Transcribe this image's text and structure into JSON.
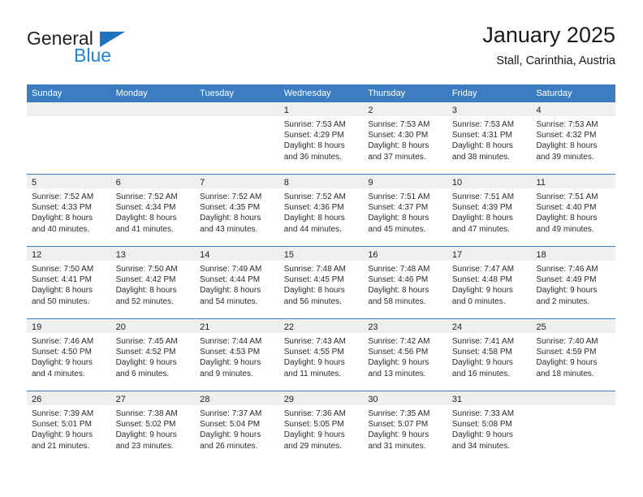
{
  "logo": {
    "word_one": "General",
    "word_two": "Blue",
    "triangle_icon": "triangle-icon",
    "accent_dark": "#1f72bd",
    "accent_light": "#1f86d4"
  },
  "header": {
    "title": "January 2025",
    "subtitle": "Stall, Carinthia, Austria"
  },
  "theme": {
    "header_blue": "#3b7dc0",
    "band_gray": "#efefef",
    "text": "#222222"
  },
  "weekdays": [
    "Sunday",
    "Monday",
    "Tuesday",
    "Wednesday",
    "Thursday",
    "Friday",
    "Saturday"
  ],
  "weeks": [
    [
      {
        "empty": true
      },
      {
        "empty": true
      },
      {
        "empty": true
      },
      {
        "day": "1",
        "sunrise": "Sunrise: 7:53 AM",
        "sunset": "Sunset: 4:29 PM",
        "daylight_1": "Daylight: 8 hours",
        "daylight_2": "and 36 minutes."
      },
      {
        "day": "2",
        "sunrise": "Sunrise: 7:53 AM",
        "sunset": "Sunset: 4:30 PM",
        "daylight_1": "Daylight: 8 hours",
        "daylight_2": "and 37 minutes."
      },
      {
        "day": "3",
        "sunrise": "Sunrise: 7:53 AM",
        "sunset": "Sunset: 4:31 PM",
        "daylight_1": "Daylight: 8 hours",
        "daylight_2": "and 38 minutes."
      },
      {
        "day": "4",
        "sunrise": "Sunrise: 7:53 AM",
        "sunset": "Sunset: 4:32 PM",
        "daylight_1": "Daylight: 8 hours",
        "daylight_2": "and 39 minutes."
      }
    ],
    [
      {
        "day": "5",
        "sunrise": "Sunrise: 7:52 AM",
        "sunset": "Sunset: 4:33 PM",
        "daylight_1": "Daylight: 8 hours",
        "daylight_2": "and 40 minutes."
      },
      {
        "day": "6",
        "sunrise": "Sunrise: 7:52 AM",
        "sunset": "Sunset: 4:34 PM",
        "daylight_1": "Daylight: 8 hours",
        "daylight_2": "and 41 minutes."
      },
      {
        "day": "7",
        "sunrise": "Sunrise: 7:52 AM",
        "sunset": "Sunset: 4:35 PM",
        "daylight_1": "Daylight: 8 hours",
        "daylight_2": "and 43 minutes."
      },
      {
        "day": "8",
        "sunrise": "Sunrise: 7:52 AM",
        "sunset": "Sunset: 4:36 PM",
        "daylight_1": "Daylight: 8 hours",
        "daylight_2": "and 44 minutes."
      },
      {
        "day": "9",
        "sunrise": "Sunrise: 7:51 AM",
        "sunset": "Sunset: 4:37 PM",
        "daylight_1": "Daylight: 8 hours",
        "daylight_2": "and 45 minutes."
      },
      {
        "day": "10",
        "sunrise": "Sunrise: 7:51 AM",
        "sunset": "Sunset: 4:39 PM",
        "daylight_1": "Daylight: 8 hours",
        "daylight_2": "and 47 minutes."
      },
      {
        "day": "11",
        "sunrise": "Sunrise: 7:51 AM",
        "sunset": "Sunset: 4:40 PM",
        "daylight_1": "Daylight: 8 hours",
        "daylight_2": "and 49 minutes."
      }
    ],
    [
      {
        "day": "12",
        "sunrise": "Sunrise: 7:50 AM",
        "sunset": "Sunset: 4:41 PM",
        "daylight_1": "Daylight: 8 hours",
        "daylight_2": "and 50 minutes."
      },
      {
        "day": "13",
        "sunrise": "Sunrise: 7:50 AM",
        "sunset": "Sunset: 4:42 PM",
        "daylight_1": "Daylight: 8 hours",
        "daylight_2": "and 52 minutes."
      },
      {
        "day": "14",
        "sunrise": "Sunrise: 7:49 AM",
        "sunset": "Sunset: 4:44 PM",
        "daylight_1": "Daylight: 8 hours",
        "daylight_2": "and 54 minutes."
      },
      {
        "day": "15",
        "sunrise": "Sunrise: 7:48 AM",
        "sunset": "Sunset: 4:45 PM",
        "daylight_1": "Daylight: 8 hours",
        "daylight_2": "and 56 minutes."
      },
      {
        "day": "16",
        "sunrise": "Sunrise: 7:48 AM",
        "sunset": "Sunset: 4:46 PM",
        "daylight_1": "Daylight: 8 hours",
        "daylight_2": "and 58 minutes."
      },
      {
        "day": "17",
        "sunrise": "Sunrise: 7:47 AM",
        "sunset": "Sunset: 4:48 PM",
        "daylight_1": "Daylight: 9 hours",
        "daylight_2": "and 0 minutes."
      },
      {
        "day": "18",
        "sunrise": "Sunrise: 7:46 AM",
        "sunset": "Sunset: 4:49 PM",
        "daylight_1": "Daylight: 9 hours",
        "daylight_2": "and 2 minutes."
      }
    ],
    [
      {
        "day": "19",
        "sunrise": "Sunrise: 7:46 AM",
        "sunset": "Sunset: 4:50 PM",
        "daylight_1": "Daylight: 9 hours",
        "daylight_2": "and 4 minutes."
      },
      {
        "day": "20",
        "sunrise": "Sunrise: 7:45 AM",
        "sunset": "Sunset: 4:52 PM",
        "daylight_1": "Daylight: 9 hours",
        "daylight_2": "and 6 minutes."
      },
      {
        "day": "21",
        "sunrise": "Sunrise: 7:44 AM",
        "sunset": "Sunset: 4:53 PM",
        "daylight_1": "Daylight: 9 hours",
        "daylight_2": "and 9 minutes."
      },
      {
        "day": "22",
        "sunrise": "Sunrise: 7:43 AM",
        "sunset": "Sunset: 4:55 PM",
        "daylight_1": "Daylight: 9 hours",
        "daylight_2": "and 11 minutes."
      },
      {
        "day": "23",
        "sunrise": "Sunrise: 7:42 AM",
        "sunset": "Sunset: 4:56 PM",
        "daylight_1": "Daylight: 9 hours",
        "daylight_2": "and 13 minutes."
      },
      {
        "day": "24",
        "sunrise": "Sunrise: 7:41 AM",
        "sunset": "Sunset: 4:58 PM",
        "daylight_1": "Daylight: 9 hours",
        "daylight_2": "and 16 minutes."
      },
      {
        "day": "25",
        "sunrise": "Sunrise: 7:40 AM",
        "sunset": "Sunset: 4:59 PM",
        "daylight_1": "Daylight: 9 hours",
        "daylight_2": "and 18 minutes."
      }
    ],
    [
      {
        "day": "26",
        "sunrise": "Sunrise: 7:39 AM",
        "sunset": "Sunset: 5:01 PM",
        "daylight_1": "Daylight: 9 hours",
        "daylight_2": "and 21 minutes."
      },
      {
        "day": "27",
        "sunrise": "Sunrise: 7:38 AM",
        "sunset": "Sunset: 5:02 PM",
        "daylight_1": "Daylight: 9 hours",
        "daylight_2": "and 23 minutes."
      },
      {
        "day": "28",
        "sunrise": "Sunrise: 7:37 AM",
        "sunset": "Sunset: 5:04 PM",
        "daylight_1": "Daylight: 9 hours",
        "daylight_2": "and 26 minutes."
      },
      {
        "day": "29",
        "sunrise": "Sunrise: 7:36 AM",
        "sunset": "Sunset: 5:05 PM",
        "daylight_1": "Daylight: 9 hours",
        "daylight_2": "and 29 minutes."
      },
      {
        "day": "30",
        "sunrise": "Sunrise: 7:35 AM",
        "sunset": "Sunset: 5:07 PM",
        "daylight_1": "Daylight: 9 hours",
        "daylight_2": "and 31 minutes."
      },
      {
        "day": "31",
        "sunrise": "Sunrise: 7:33 AM",
        "sunset": "Sunset: 5:08 PM",
        "daylight_1": "Daylight: 9 hours",
        "daylight_2": "and 34 minutes."
      },
      {
        "empty": true
      }
    ]
  ]
}
